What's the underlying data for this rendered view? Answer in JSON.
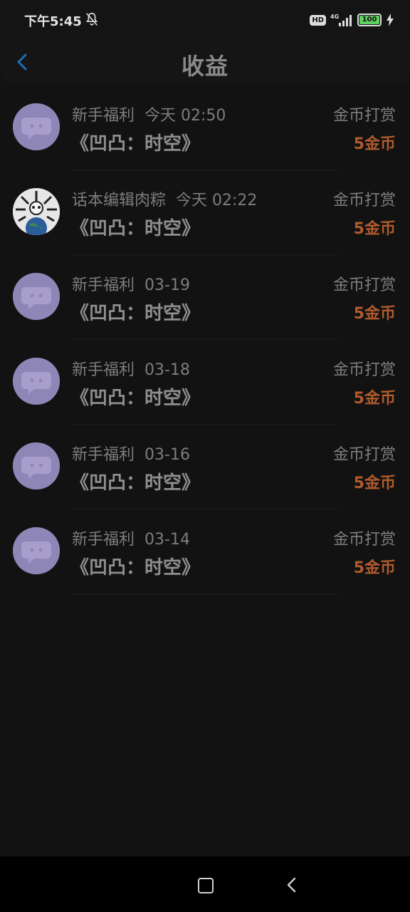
{
  "status_bar": {
    "time": "下午5:45",
    "hd": "HD",
    "network": "4G",
    "battery": "100"
  },
  "header": {
    "title": "收益"
  },
  "records": [
    {
      "user": "新手福利",
      "time": "今天 02:50",
      "work": "《凹凸：时空》",
      "type": "金币打赏",
      "amount": "5金币",
      "avatar": "chat-bubble-avatar"
    },
    {
      "user": "话本编辑肉粽",
      "time": "今天 02:22",
      "work": "《凹凸：时空》",
      "type": "金币打赏",
      "amount": "5金币",
      "avatar": "panda-earth-avatar"
    },
    {
      "user": "新手福利",
      "time": "03-19",
      "work": "《凹凸：时空》",
      "type": "金币打赏",
      "amount": "5金币",
      "avatar": "chat-bubble-avatar"
    },
    {
      "user": "新手福利",
      "time": "03-18",
      "work": "《凹凸：时空》",
      "type": "金币打赏",
      "amount": "5金币",
      "avatar": "chat-bubble-avatar"
    },
    {
      "user": "新手福利",
      "time": "03-16",
      "work": "《凹凸：时空》",
      "type": "金币打赏",
      "amount": "5金币",
      "avatar": "chat-bubble-avatar"
    },
    {
      "user": "新手福利",
      "time": "03-14",
      "work": "《凹凸：时空》",
      "type": "金币打赏",
      "amount": "5金币",
      "avatar": "chat-bubble-avatar"
    }
  ],
  "colors": {
    "accent_back": "#1f6fb3",
    "amount": "#b05a2c",
    "avatar_bg": "#8f86b8"
  }
}
